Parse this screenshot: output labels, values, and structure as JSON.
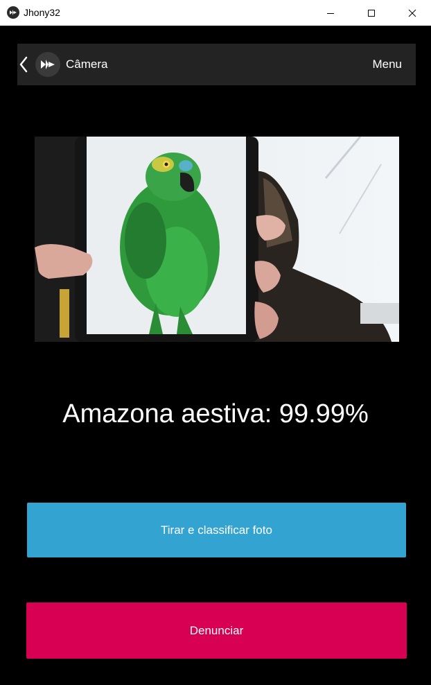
{
  "window": {
    "title": "Jhony32",
    "controls": [
      "minimize-icon",
      "maximize-icon",
      "close-icon"
    ]
  },
  "actionbar": {
    "back_icon": "chevron-left-icon",
    "logo": "kivy-logo-icon",
    "title": "Câmera",
    "menu_label": "Menu"
  },
  "camera": {
    "content": "camera-preview-image"
  },
  "result": {
    "text": "Amazona aestiva: 99.99%"
  },
  "buttons": {
    "capture_label": "Tirar e classificar foto",
    "report_label": "Denunciar"
  },
  "colors": {
    "background": "#000000",
    "actionbar": "#232323",
    "capture_button": "#33a4d2",
    "report_button": "#d70052"
  }
}
